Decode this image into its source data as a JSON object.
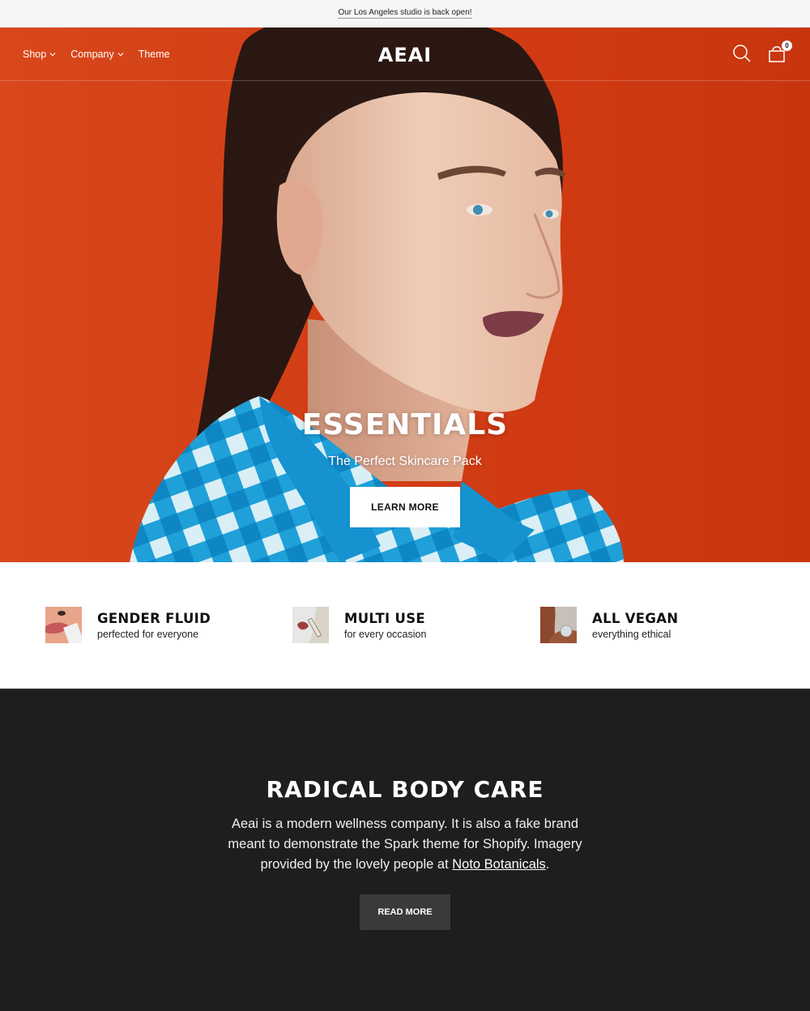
{
  "announcement": {
    "text": "Our Los Angeles studio is back open!"
  },
  "header": {
    "logo": "AEAI",
    "nav": [
      {
        "label": "Shop",
        "has_dropdown": true
      },
      {
        "label": "Company",
        "has_dropdown": true
      },
      {
        "label": "Theme",
        "has_dropdown": false
      }
    ],
    "icons": {
      "search": "search-icon",
      "cart": "shopping-bag-icon"
    },
    "cart_count": "0"
  },
  "hero": {
    "title": "ESSENTIALS",
    "subtitle": "The Perfect Skincare Pack",
    "button_label": "LEARN MORE",
    "background_color": "#d33f16"
  },
  "features": [
    {
      "title": "GENDER FLUID",
      "subtitle": "perfected for everyone",
      "image": "lips-product-thumbnail"
    },
    {
      "title": "MULTI USE",
      "subtitle": "for every occasion",
      "image": "lipstick-swatch-thumbnail"
    },
    {
      "title": "ALL VEGAN",
      "subtitle": "everything ethical",
      "image": "shoulder-cream-thumbnail"
    }
  ],
  "about": {
    "title": "RADICAL BODY CARE",
    "text_before_link": "Aeai is a modern wellness company. It is also a fake brand meant to demonstrate the Spark theme for Shopify. Imagery provided by the lovely people at ",
    "link_text": "Noto Botanicals",
    "text_after_link": ".",
    "button_label": "READ MORE",
    "background_color": "#1e1e1e"
  }
}
